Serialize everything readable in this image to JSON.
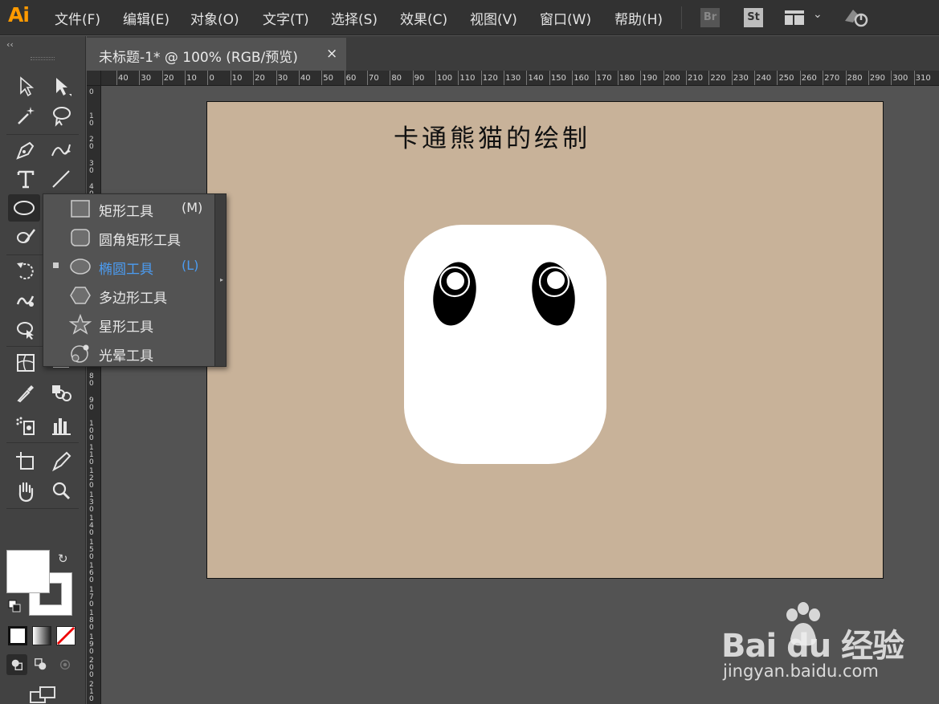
{
  "app": {
    "logo": "Ai",
    "accent": "#ff9a00"
  },
  "menu": {
    "items": [
      "文件(F)",
      "编辑(E)",
      "对象(O)",
      "文字(T)",
      "选择(S)",
      "效果(C)",
      "视图(V)",
      "窗口(W)",
      "帮助(H)"
    ],
    "badges": {
      "bridge": "Br",
      "stock": "St"
    }
  },
  "toolbar": {
    "collapse_glyph": "‹‹"
  },
  "document": {
    "tab_title": "未标题-1* @ 100% (RGB/预览)",
    "close_glyph": "×"
  },
  "rulers": {
    "horizontal": [
      "40",
      "30",
      "20",
      "10",
      "0",
      "10",
      "20",
      "30",
      "40",
      "50",
      "60",
      "70",
      "80",
      "90",
      "100",
      "110",
      "120",
      "130",
      "140",
      "150",
      "160",
      "170",
      "180",
      "190",
      "200",
      "210",
      "220",
      "230",
      "240",
      "250",
      "260",
      "270",
      "280",
      "290",
      "300",
      "310"
    ],
    "vertical": [
      "0",
      "10",
      "20",
      "30",
      "40",
      "10",
      "20",
      "30",
      "40",
      "50",
      "60",
      "70",
      "80",
      "90",
      "100",
      "110",
      "120",
      "130",
      "140",
      "150",
      "160",
      "170",
      "180",
      "190",
      "200",
      "210"
    ]
  },
  "artboard": {
    "title": "卡通熊猫的绘制",
    "background": "#c8b299"
  },
  "shape_flyout": {
    "items": [
      {
        "label": "矩形工具",
        "shortcut": "(M)",
        "icon": "rectangle-icon",
        "selected": false
      },
      {
        "label": "圆角矩形工具",
        "shortcut": "",
        "icon": "rounded-rectangle-icon",
        "selected": false
      },
      {
        "label": "椭圆工具",
        "shortcut": "(L)",
        "icon": "ellipse-icon",
        "selected": true
      },
      {
        "label": "多边形工具",
        "shortcut": "",
        "icon": "polygon-icon",
        "selected": false
      },
      {
        "label": "星形工具",
        "shortcut": "",
        "icon": "star-icon",
        "selected": false
      },
      {
        "label": "光晕工具",
        "shortcut": "",
        "icon": "flare-icon",
        "selected": false
      }
    ],
    "selected_color": "#4b9cf2"
  },
  "colors": {
    "fill": "#ffffff",
    "stroke": "#ffffff"
  },
  "watermark": {
    "brand": "Bai du 经验",
    "url": "jingyan.baidu.com"
  }
}
